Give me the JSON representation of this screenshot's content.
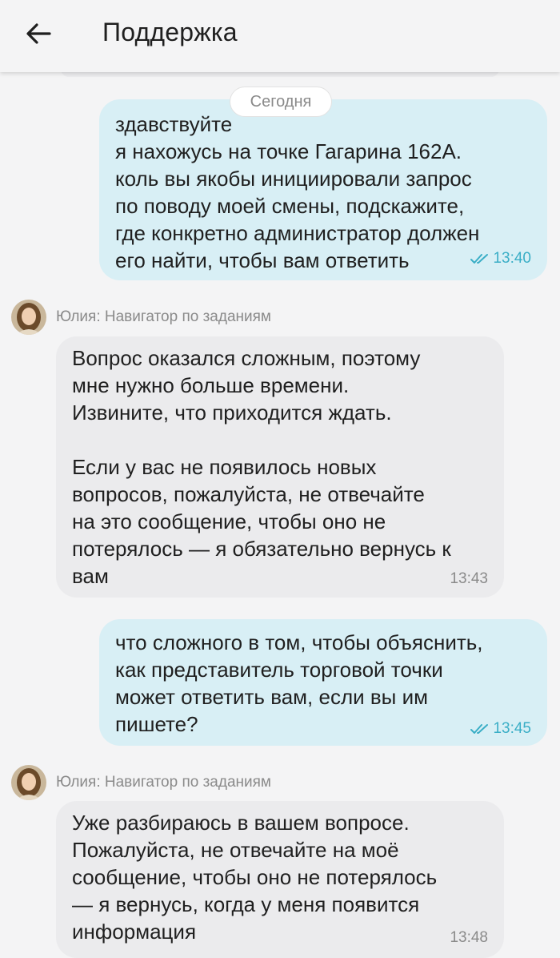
{
  "header": {
    "title": "Поддержка"
  },
  "date_separator": "Сегодня",
  "messages": [
    {
      "text": "здавствуйте\nя нахожусь на точке Гагарина 162А.\nколь вы якобы инициировали запрос\nпо поводу моей смены, подскажите,\nгде конкретно администратор должен\nего найти, чтобы вам ответить",
      "time": "13:40"
    },
    {
      "sender": "Юлия: Навигатор по заданиям",
      "text": "Вопрос оказался сложным, поэтому\nмне нужно больше времени.\nИзвините, что приходится ждать.\n\nЕсли у вас не появилось новых\nвопросов, пожалуйста, не отвечайте\nна это сообщение, чтобы оно не\nпотерялось — я обязательно вернусь к\nвам",
      "time": "13:43"
    },
    {
      "text": "что сложного в том, чтобы объяснить,\nкак представитель торговой точки\nможет ответить вам, если вы им\nпишете?",
      "time": "13:45"
    },
    {
      "sender": "Юлия: Навигатор по заданиям",
      "text": "Уже разбираюсь в вашем вопросе.\nПожалуйста, не отвечайте на моё\nсообщение, чтобы оно не потерялось\n— я вернусь, когда у меня появится\nинформация",
      "time": "13:48"
    }
  ],
  "colors": {
    "outgoing": "#d8eff5",
    "incoming": "#ebebed",
    "read_check": "#3aaec6"
  }
}
